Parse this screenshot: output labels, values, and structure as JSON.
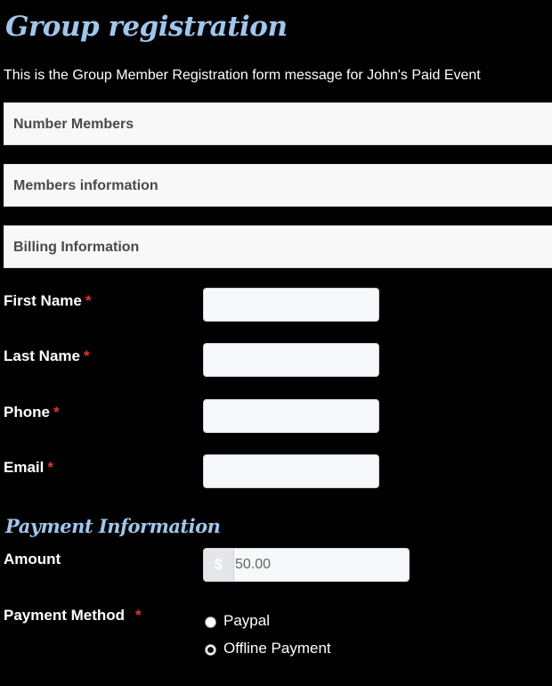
{
  "page": {
    "title": "Group registration",
    "intro": "This is the Group Member Registration form message for John's Paid Event"
  },
  "sections": [
    {
      "label": "Number Members"
    },
    {
      "label": "Members information"
    },
    {
      "label": "Billing Information"
    }
  ],
  "fields": {
    "required_marker": "*",
    "first_name": {
      "label": "First Name",
      "value": ""
    },
    "last_name": {
      "label": "Last Name",
      "value": ""
    },
    "phone": {
      "label": "Phone",
      "value": ""
    },
    "email": {
      "label": "Email",
      "value": ""
    }
  },
  "payment": {
    "heading": "Payment Information",
    "amount_label": "Amount",
    "currency_symbol": "$",
    "amount_value": "50.00",
    "method_label": "Payment Method",
    "methods": [
      {
        "label": "Paypal",
        "selected": false
      },
      {
        "label": "Offline Payment",
        "selected": true
      }
    ]
  },
  "colors": {
    "background": "#000000",
    "heading": "#9fc6ec",
    "required": "#e8322b",
    "section_bar": "#f8f8f8"
  }
}
